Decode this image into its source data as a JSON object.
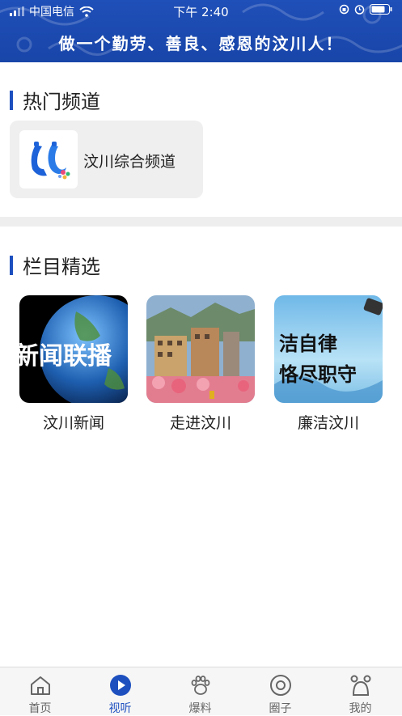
{
  "status_bar": {
    "carrier": "中国电信",
    "time": "下午 2:40"
  },
  "header": {
    "slogan": "做一个勤劳、善良、感恩的汶川人！"
  },
  "hot_channels": {
    "title": "热门频道",
    "items": [
      {
        "name": "汶川综合频道"
      }
    ]
  },
  "columns": {
    "title": "栏目精选",
    "items": [
      {
        "name": "汶川新闻",
        "thumb_text": "新闻联播"
      },
      {
        "name": "走进汶川"
      },
      {
        "name": "廉洁汶川",
        "thumb_text_1": "洁自律",
        "thumb_text_2": "恪尽职守"
      }
    ]
  },
  "tabbar": {
    "items": [
      {
        "label": "首页",
        "icon": "home-icon"
      },
      {
        "label": "视听",
        "icon": "play-icon",
        "active": true
      },
      {
        "label": "爆料",
        "icon": "paw-icon"
      },
      {
        "label": "圈子",
        "icon": "circle-icon"
      },
      {
        "label": "我的",
        "icon": "profile-icon"
      }
    ]
  },
  "colors": {
    "brand_blue": "#1d4fbf",
    "header_blue": "#1845a8"
  }
}
